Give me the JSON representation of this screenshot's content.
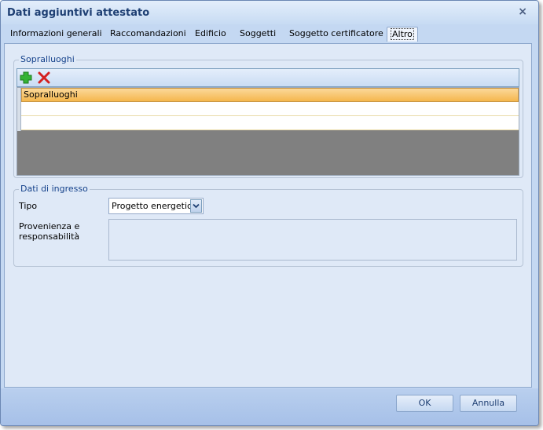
{
  "window": {
    "title": "Dati aggiuntivi attestato",
    "close_glyph": "×"
  },
  "tabs": [
    {
      "label": "Informazioni generali",
      "active": false
    },
    {
      "label": "Raccomandazioni",
      "active": false
    },
    {
      "label": "Edificio",
      "active": false
    },
    {
      "label": "Soggetti",
      "active": false
    },
    {
      "label": "Soggetto certificatore",
      "active": false
    },
    {
      "label": "Altro",
      "active": true
    }
  ],
  "sopralluoghi": {
    "legend": "Sopralluoghi",
    "toolbar": {
      "add_icon": "plus-icon",
      "delete_icon": "x-icon"
    },
    "grid": {
      "header": "Sopralluoghi",
      "rows": [
        "",
        ""
      ]
    }
  },
  "dati_ingresso": {
    "legend": "Dati di ingresso",
    "tipo_label": "Tipo",
    "tipo_value": "Progetto energetico",
    "provenienza_label_1": "Provenienza e",
    "provenienza_label_2": "responsabilità",
    "provenienza_value": ""
  },
  "footer": {
    "ok_label": "OK",
    "cancel_label": "Annulla"
  },
  "colors": {
    "accent": "#15428b",
    "header_orange": "#f5b74d",
    "grid_gray": "#808080",
    "add": "#2ea52e",
    "delete": "#d42020"
  }
}
